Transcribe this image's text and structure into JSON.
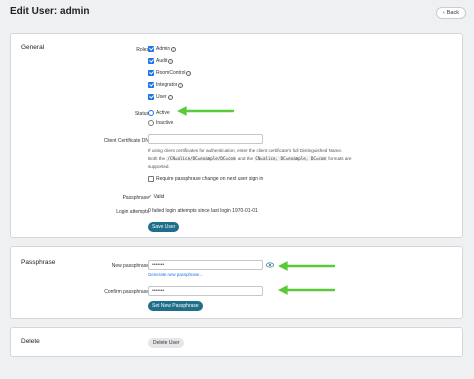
{
  "page": {
    "title": "Edit User: admin",
    "back_label": "Back"
  },
  "general": {
    "section_title": "General",
    "roles_label": "Roles",
    "roles": [
      {
        "label": "Admin",
        "checked": true,
        "info": true
      },
      {
        "label": "Audit",
        "checked": true,
        "info": true
      },
      {
        "label": "RoomControl",
        "checked": true,
        "info": true
      },
      {
        "label": "Integrator",
        "checked": true,
        "info": true
      },
      {
        "label": "User",
        "checked": true,
        "info": true
      }
    ],
    "status_label": "Status",
    "status_options": [
      {
        "label": "Active",
        "selected": true
      },
      {
        "label": "Inactive",
        "selected": false
      }
    ],
    "cert_label": "Client Certificate DN",
    "cert_value": "",
    "help_line1": "If using client certificates for authentication, enter the client certificate's full Distinguished Name.",
    "help_both": "Both the",
    "help_code1": "/CN=alice/DC=example/DC=com",
    "help_and": "and the",
    "help_code2": "CN=alice, DC=example, DC=com",
    "help_formats": "formats are",
    "help_line3": "supported.",
    "require_change_label": "Require passphrase change on next user sign in",
    "passphrase_label": "Passphrase",
    "passphrase_value": "Valid",
    "login_attempts_label": "Login attempts",
    "login_attempts_value": "0 failed login attempts since last login 1970-01-01",
    "save_button": "Save User"
  },
  "passphrase": {
    "section_title": "Passphrase",
    "new_label": "New passphrase",
    "new_value": "•••••••",
    "generate_link": "Generate new passphrase...",
    "confirm_label": "Confirm passphrase",
    "confirm_value": "•••••••",
    "set_button": "Set New Passphrase"
  },
  "delete": {
    "section_title": "Delete",
    "delete_button": "Delete User"
  },
  "colors": {
    "accent": "#1a73e8",
    "primary_button": "#1f6f8b",
    "annotation_arrow": "#5cc93a"
  },
  "icons": [
    "back-chevron-icon",
    "info-icon",
    "eye-icon",
    "green-arrow-icon"
  ]
}
